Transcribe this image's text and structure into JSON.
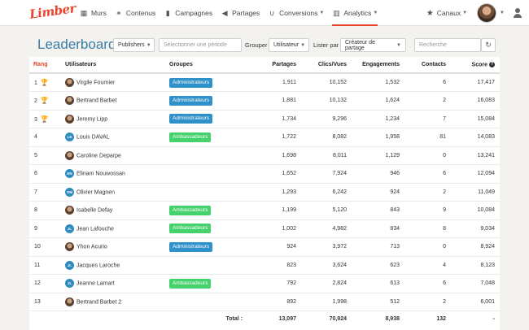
{
  "app": {
    "logo_text": "Limber"
  },
  "nav": {
    "items": [
      {
        "label": "Murs",
        "icon": "grid-icon"
      },
      {
        "label": "Contenus",
        "icon": "link-icon"
      },
      {
        "label": "Campagnes",
        "icon": "bookmark-icon"
      },
      {
        "label": "Partages",
        "icon": "megaphone-icon"
      },
      {
        "label": "Conversions",
        "icon": "magnet-icon"
      },
      {
        "label": "Analytics",
        "icon": "bar-chart-icon"
      }
    ],
    "active": "Analytics",
    "canaux_label": "Canaux"
  },
  "toolbar": {
    "title": "Leaderboard",
    "publishers_label": "Publishers",
    "period_placeholder": "Sélectionner une période",
    "grouper_label": "Grouper",
    "grouper_value": "Utilisateur",
    "lister_label": "Lister par",
    "lister_value": "Créateur de partage",
    "search_placeholder": "Recherche"
  },
  "table": {
    "headers": [
      "Rang",
      "Utilisateurs",
      "Groupes",
      "Partages",
      "Clics/Vues",
      "Engagements",
      "Contacts",
      "Score"
    ],
    "rows": [
      {
        "rank": "1",
        "trophy": "gold",
        "name": "Virgile Fournier",
        "avatar": "photo",
        "initials": "",
        "group": "Administrateurs",
        "group_type": "admin",
        "partages": "1,911",
        "clics": "10,152",
        "engagements": "1,532",
        "contacts": "6",
        "score": "17,417"
      },
      {
        "rank": "2",
        "trophy": "silver",
        "name": "Bertrand Barbet",
        "avatar": "photo",
        "initials": "",
        "group": "Administrateurs",
        "group_type": "admin",
        "partages": "1,881",
        "clics": "10,132",
        "engagements": "1,624",
        "contacts": "2",
        "score": "16,083"
      },
      {
        "rank": "3",
        "trophy": "bronze",
        "name": "Jeremy Lipp",
        "avatar": "photo",
        "initials": "",
        "group": "Administrateurs",
        "group_type": "admin",
        "partages": "1,734",
        "clics": "9,296",
        "engagements": "1,234",
        "contacts": "7",
        "score": "15,084"
      },
      {
        "rank": "4",
        "trophy": "",
        "name": "Louis DAVAL",
        "avatar": "initials",
        "initials": "LD",
        "group": "Ambassadeurs",
        "group_type": "amb",
        "partages": "1,722",
        "clics": "8,082",
        "engagements": "1,958",
        "contacts": "81",
        "score": "14,083"
      },
      {
        "rank": "5",
        "trophy": "",
        "name": "Caroline Deparpe",
        "avatar": "photo",
        "initials": "",
        "group": "",
        "group_type": "",
        "partages": "1,698",
        "clics": "8,011",
        "engagements": "1,129",
        "contacts": "0",
        "score": "13,241"
      },
      {
        "rank": "6",
        "trophy": "",
        "name": "Elinam Nouwossan",
        "avatar": "initials",
        "initials": "EN",
        "group": "",
        "group_type": "",
        "partages": "1,652",
        "clics": "7,924",
        "engagements": "946",
        "contacts": "6",
        "score": "12,094"
      },
      {
        "rank": "7",
        "trophy": "",
        "name": "Olivier Magnen",
        "avatar": "initials",
        "initials": "OM",
        "group": "",
        "group_type": "",
        "partages": "1,293",
        "clics": "6,242",
        "engagements": "924",
        "contacts": "2",
        "score": "11,049"
      },
      {
        "rank": "8",
        "trophy": "",
        "name": "Isabelle Defay",
        "avatar": "photo",
        "initials": "",
        "group": "Ambassadeurs",
        "group_type": "amb",
        "partages": "1,199",
        "clics": "5,120",
        "engagements": "843",
        "contacts": "9",
        "score": "10,084"
      },
      {
        "rank": "9",
        "trophy": "",
        "name": "Jean Lafouche",
        "avatar": "initials",
        "initials": "JL",
        "group": "Ambassadeurs",
        "group_type": "amb",
        "partages": "1,002",
        "clics": "4,982",
        "engagements": "834",
        "contacts": "8",
        "score": "9,034"
      },
      {
        "rank": "10",
        "trophy": "",
        "name": "Yhon Acurio",
        "avatar": "photo",
        "initials": "",
        "group": "Administrateurs",
        "group_type": "admin",
        "partages": "924",
        "clics": "3,972",
        "engagements": "713",
        "contacts": "0",
        "score": "8,924"
      },
      {
        "rank": "11",
        "trophy": "",
        "name": "Jacques Laroche",
        "avatar": "initials",
        "initials": "JL",
        "group": "",
        "group_type": "",
        "partages": "823",
        "clics": "3,624",
        "engagements": "623",
        "contacts": "4",
        "score": "8,123"
      },
      {
        "rank": "12",
        "trophy": "",
        "name": "Jeanne Lamart",
        "avatar": "initials",
        "initials": "JL",
        "group": "Ambassadeurs",
        "group_type": "amb",
        "partages": "792",
        "clics": "2,824",
        "engagements": "613",
        "contacts": "6",
        "score": "7,048"
      },
      {
        "rank": "13",
        "trophy": "",
        "name": "Bertrand Barbet 2",
        "avatar": "photo",
        "initials": "",
        "group": "",
        "group_type": "",
        "partages": "892",
        "clics": "1,998",
        "engagements": "512",
        "contacts": "2",
        "score": "6,001"
      }
    ],
    "totals": {
      "label": "Total :",
      "partages": "13,097",
      "clics": "70,924",
      "engagements": "8,938",
      "contacts": "132",
      "score": "-"
    }
  },
  "colors": {
    "brand": "#e8452e",
    "title": "#3a7ca5",
    "admin_badge": "#2e91c9",
    "amb_badge": "#45d16b"
  }
}
